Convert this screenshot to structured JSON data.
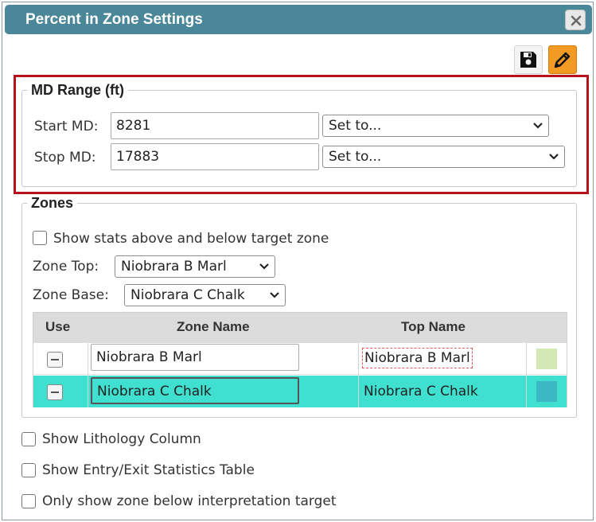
{
  "dialog": {
    "title": "Percent in Zone Settings"
  },
  "toolbar": {
    "save_icon": "floppy-disk-icon",
    "edit_icon": "pencil-icon",
    "edit_color": "#f29b24"
  },
  "md_range": {
    "legend": "MD Range (ft)",
    "start_label": "Start MD:",
    "start_value": "8281",
    "start_select": "Set to...",
    "stop_label": "Stop MD:",
    "stop_value": "17883",
    "stop_select": "Set to..."
  },
  "zones": {
    "legend": "Zones",
    "show_stats_label": "Show stats above and below target zone",
    "zone_top_label": "Zone Top:",
    "zone_top_value": "Niobrara B Marl",
    "zone_base_label": "Zone Base:",
    "zone_base_value": "Niobrara C Chalk",
    "table": {
      "headers": [
        "Use",
        "Zone Name",
        "Top Name"
      ],
      "rows": [
        {
          "zone_name": "Niobrara B Marl",
          "top_name": "Niobrara B Marl",
          "color": "#d4e8b4"
        },
        {
          "zone_name": "Niobrara C Chalk",
          "top_name": "Niobrara C Chalk",
          "color": "#3cb8c4"
        }
      ]
    }
  },
  "options": {
    "lithology_label": "Show Lithology Column",
    "entry_exit_label": "Show Entry/Exit Statistics Table",
    "only_below_label": "Only show zone below interpretation target"
  },
  "colors": {
    "titlebar": "#4a8799",
    "highlight": "#b5121b",
    "selected_row": "#40e0d0"
  }
}
